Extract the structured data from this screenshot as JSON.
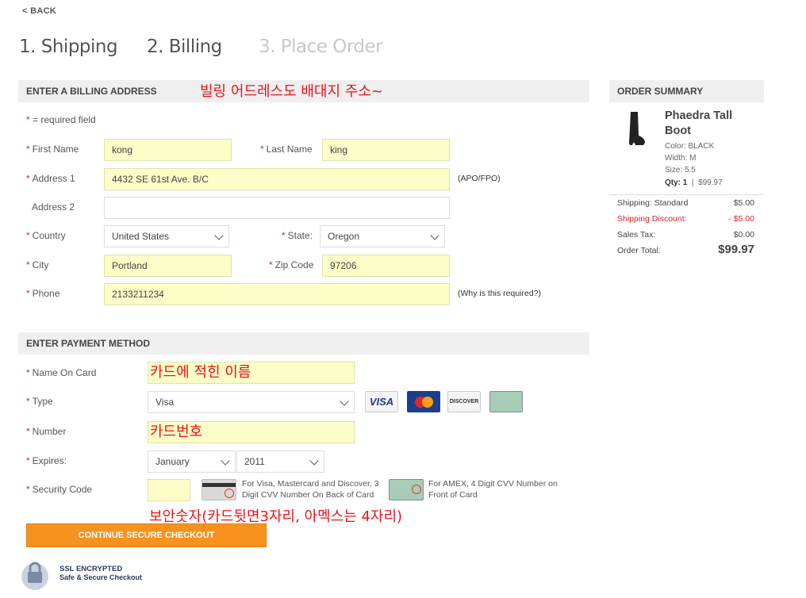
{
  "nav": {
    "back_label": "< BACK"
  },
  "steps": [
    "1. Shipping",
    "2. Billing",
    "3. Place Order"
  ],
  "billing": {
    "header": "ENTER A BILLING ADDRESS",
    "annotation": "빌링 어드레스도 배대지 주소~",
    "required_note": "= required field",
    "first_name": {
      "label": "First Name",
      "value": "kong"
    },
    "last_name": {
      "label": "Last Name",
      "value": "king"
    },
    "address1": {
      "label": "Address 1",
      "value": "4432 SE 61st Ave. B/C",
      "note": "(APO/FPO)"
    },
    "address2": {
      "label": "Address 2",
      "value": ""
    },
    "country": {
      "label": "Country",
      "value": "United States"
    },
    "state": {
      "label": "State:",
      "value": "Oregon"
    },
    "city": {
      "label": "City",
      "value": "Portland"
    },
    "zip": {
      "label": "Zip Code",
      "value": "97206"
    },
    "phone": {
      "label": "Phone",
      "value": "2133211234",
      "note": "(Why is this required?)"
    }
  },
  "payment": {
    "header": "ENTER PAYMENT METHOD",
    "name_on_card": {
      "label": "Name On Card",
      "value": "카드에 적힌 이름"
    },
    "type": {
      "label": "Type",
      "value": "Visa"
    },
    "card_logos": [
      "VISA",
      "MasterCard",
      "DISCOVER",
      "AMEX"
    ],
    "number": {
      "label": "Number",
      "value": "카드번호"
    },
    "expires": {
      "label": "Expires:",
      "month": "January",
      "year": "2011"
    },
    "security_code": {
      "label": "Security Code",
      "value": "",
      "visa_note": "For Visa, Mastercard and Discover, 3 Digit CVV Number On Back of Card",
      "amex_note": "For AMEX, 4 Digit CVV Number on Front of Card"
    },
    "annotation": "보안숫자(카드뒷면3자리, 아멕스는 4자리)",
    "submit_label": "CONTINUE SECURE CHECKOUT",
    "ssl_line1": "SSL ENCRYPTED",
    "ssl_line2": "Safe & Secure Checkout"
  },
  "summary": {
    "header": "ORDER SUMMARY",
    "product": {
      "name": "Phaedra Tall Boot",
      "color": "Color: BLACK",
      "width": "Width: M",
      "size": "Size: 5.5",
      "qty": "Qty: 1",
      "price": "$99.97"
    },
    "rows": [
      {
        "label": "Shipping: Standard",
        "value": "$5.00"
      },
      {
        "label": "Shipping Discount:",
        "value": "- $5.00"
      },
      {
        "label": "Sales Tax:",
        "value": "$0.00"
      },
      {
        "label": "Order Total:",
        "value": "$99.97"
      }
    ]
  },
  "colors": {
    "accent": "#f7921e",
    "required": "#d9242a",
    "annotation": "#e8141b",
    "autofill": "#fdfdc8"
  }
}
